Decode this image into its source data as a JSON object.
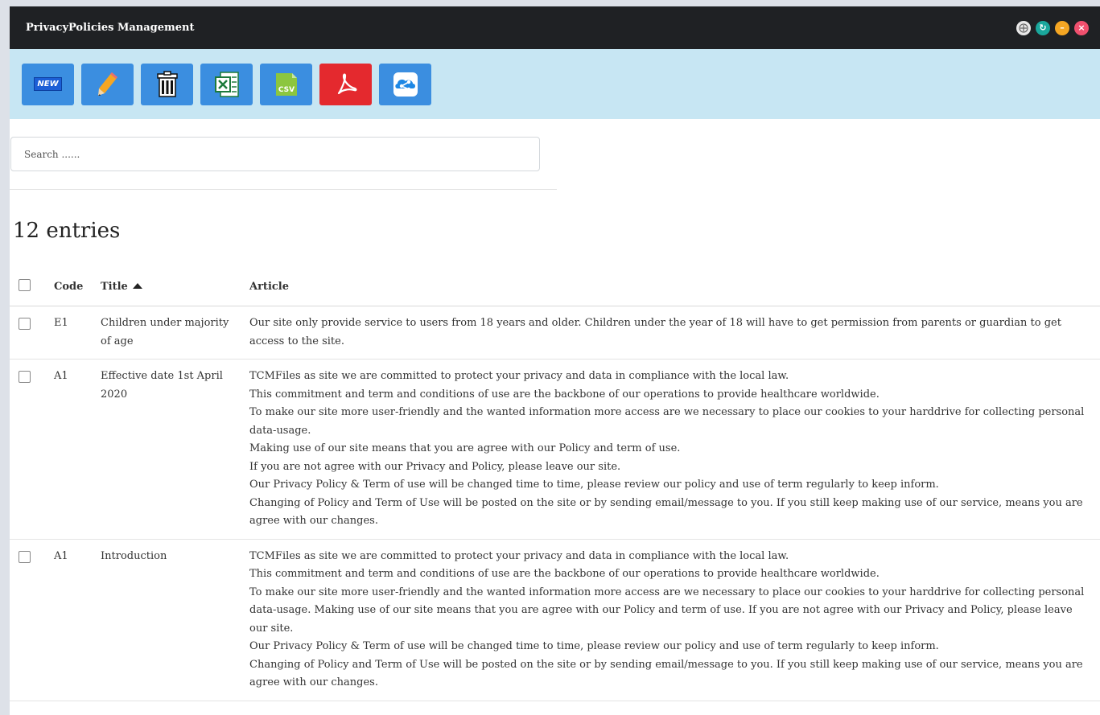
{
  "window": {
    "title": "PrivacyPolicies Management"
  },
  "toolbar": {
    "new_label": "NEW",
    "csv_label": "CSV",
    "buttons": [
      "new-icon",
      "edit-icon",
      "trash-icon",
      "excel-icon",
      "csv-icon",
      "pdf-icon",
      "share-icon"
    ]
  },
  "search": {
    "placeholder": "Search ......"
  },
  "summary": {
    "entries": "12 entries"
  },
  "table": {
    "headers": {
      "code": "Code",
      "title": "Title",
      "article": "Article"
    },
    "rows": [
      {
        "code": "E1",
        "title": "Children under majority of age",
        "article": [
          "Our site only provide service to users from 18 years and older. Children under the year of 18 will have to get permission from parents or guardian to get access to the site."
        ]
      },
      {
        "code": "A1",
        "title": "Effective date 1st April 2020",
        "article": [
          "TCMFiles as site we are committed to protect your privacy and data in compliance with the local law.",
          "This commitment and term and conditions of use are the backbone of our operations to provide healthcare worldwide.",
          "To make our site more user-friendly and the wanted information more access are we necessary to place our cookies to your harddrive for collecting personal data-usage.",
          "Making use of our site means that you are agree with our Policy and term of use.",
          "If you are not agree with our Privacy and Policy, please leave our site.",
          "Our Privacy Policy & Term of use will be changed time to time, please review our policy and use of term regularly to keep inform.",
          "Changing of Policy and Term of Use will be posted on the site or by sending email/message to you. If you still keep making use of our service, means you are agree with our changes."
        ]
      },
      {
        "code": "A1",
        "title": "Introduction",
        "article": [
          "TCMFiles as site we are committed to protect your privacy and data in compliance with the local law.",
          "This commitment and term and conditions of use are the backbone of our operations to provide healthcare worldwide.",
          "To make our site more user-friendly and the wanted information more access are we necessary to place our cookies to your harddrive for collecting personal data-usage. Making use of our site means that you are agree with our Policy and term of use. If you are not agree with our Privacy and Policy, please leave our site.",
          "Our Privacy Policy & Term of use will be changed time to time, please review our policy and use of term regularly to keep inform.",
          "Changing of Policy and Term of Use will be posted on the site or by sending email/message to you. If you still keep making use of our service, means you are agree with our changes."
        ]
      }
    ]
  },
  "colors": {
    "titlebar": "#1f2124",
    "toolbar_bg": "#c7e6f3",
    "button_bg": "#3b8ee0",
    "ctrl_move": "#e8e8e8",
    "ctrl_refresh": "#1aa79c",
    "ctrl_minimize": "#f5a623",
    "ctrl_close": "#f0506e"
  }
}
